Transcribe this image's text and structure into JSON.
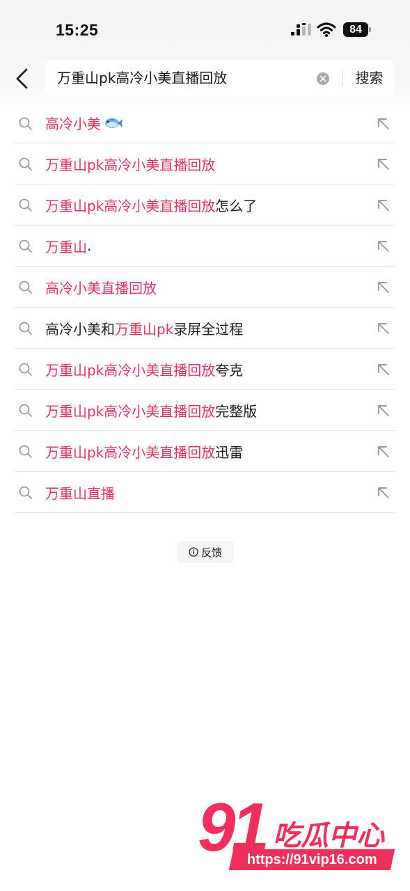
{
  "status_bar": {
    "time": "15:25",
    "battery": "84"
  },
  "search": {
    "query": "万重山pk高冷小美直播回放",
    "button_label": "搜索"
  },
  "suggestions": [
    {
      "parts": [
        {
          "text": "高冷小美",
          "highlight": true
        }
      ],
      "emoji": "fish"
    },
    {
      "parts": [
        {
          "text": "万重山pk高冷小美直播回放",
          "highlight": true
        }
      ]
    },
    {
      "parts": [
        {
          "text": "万重山pk高冷小美直播回放",
          "highlight": true
        },
        {
          "text": "怎么了",
          "highlight": false
        }
      ]
    },
    {
      "parts": [
        {
          "text": "万重山",
          "highlight": true
        },
        {
          "text": ".",
          "highlight": false
        }
      ]
    },
    {
      "parts": [
        {
          "text": "高冷小美直播回放",
          "highlight": true
        }
      ]
    },
    {
      "parts": [
        {
          "text": "高冷小美和",
          "highlight": false
        },
        {
          "text": "万重山pk",
          "highlight": true
        },
        {
          "text": "录屏全过程",
          "highlight": false
        }
      ]
    },
    {
      "parts": [
        {
          "text": "万重山pk高冷小美直播回放",
          "highlight": true
        },
        {
          "text": "夸克",
          "highlight": false
        }
      ]
    },
    {
      "parts": [
        {
          "text": "万重山pk高冷小美直播回放",
          "highlight": true
        },
        {
          "text": "完整版",
          "highlight": false
        }
      ]
    },
    {
      "parts": [
        {
          "text": "万重山pk高冷小美直播回放",
          "highlight": true
        },
        {
          "text": "迅雷",
          "highlight": false
        }
      ]
    },
    {
      "parts": [
        {
          "text": "万重山直播",
          "highlight": true
        }
      ]
    }
  ],
  "feedback": {
    "label": "反馈"
  },
  "watermark": {
    "number": "91",
    "name": "吃瓜中心",
    "url": "https://91vip16.com"
  },
  "colors": {
    "highlight": "#e0345c",
    "watermark": "#f0305c"
  }
}
